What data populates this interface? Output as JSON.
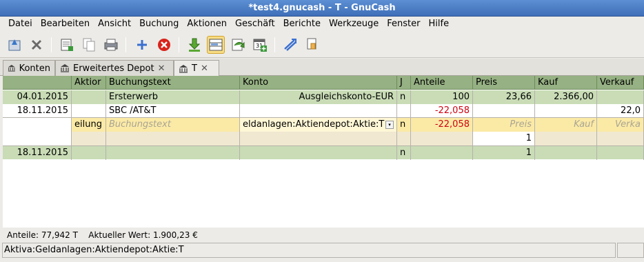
{
  "window": {
    "title": "*test4.gnucash - T - GnuCash"
  },
  "menu": [
    {
      "label": "Datei"
    },
    {
      "label": "Bearbeiten"
    },
    {
      "label": "Ansicht"
    },
    {
      "label": "Buchung"
    },
    {
      "label": "Aktionen"
    },
    {
      "label": "Geschäft"
    },
    {
      "label": "Berichte"
    },
    {
      "label": "Werkzeuge"
    },
    {
      "label": "Fenster"
    },
    {
      "label": "Hilfe"
    }
  ],
  "toolbar_icons": [
    "save-icon",
    "close-icon",
    "duplicate-icon",
    "copy-icon",
    "print-icon",
    "add-icon",
    "delete-icon",
    "enter-icon",
    "split-icon",
    "jump-icon",
    "schedule-icon",
    "reconcile-icon",
    "transfer-icon"
  ],
  "tabs": [
    {
      "label": "Konten"
    },
    {
      "label": "Erweitertes Depot"
    },
    {
      "label": "T"
    }
  ],
  "register": {
    "headers": [
      "",
      "Aktior",
      "Buchungstext",
      "Konto",
      "J",
      "Anteile",
      "Preis",
      "Kauf",
      "Verkauf"
    ],
    "rows": [
      {
        "date": "04.01.2015",
        "action": "",
        "desc": "Ersterwerb",
        "account": "Ausgleichskonto-EUR",
        "r": "n",
        "shares": "100",
        "price": "23,66",
        "buy": "2.366,00",
        "sell": ""
      },
      {
        "date": "18.11.2015",
        "action": "",
        "desc": "SBC /AT&T",
        "account": "",
        "r": "",
        "shares": "",
        "price": "",
        "buy": "",
        "sell": "22,0"
      },
      {
        "date": "",
        "action": "eilung",
        "desc": "Buchungstext",
        "account": "eldanlagen:Aktiendepot:Aktie:T",
        "r": "n",
        "shares": "-22,058",
        "price": "Preis",
        "buy": "Kauf",
        "sell": "Verka"
      },
      {
        "date": "",
        "action": "",
        "desc": "",
        "account": "",
        "r": "",
        "shares": "",
        "price": "1",
        "buy": "",
        "sell": ""
      },
      {
        "date": "18.11.2015",
        "action": "",
        "desc": "",
        "account": "",
        "r": "n",
        "shares": "",
        "price": "1",
        "buy": "",
        "sell": ""
      }
    ],
    "row2_shares": "-22,058"
  },
  "summary": {
    "shares_label": "Anteile:",
    "shares_value": "77,942 T",
    "value_label": "Aktueller Wert:",
    "value_value": "1.900,23 €"
  },
  "status": {
    "text": "Aktiva:Geldanlagen:Aktiendepot:Aktie:T"
  }
}
